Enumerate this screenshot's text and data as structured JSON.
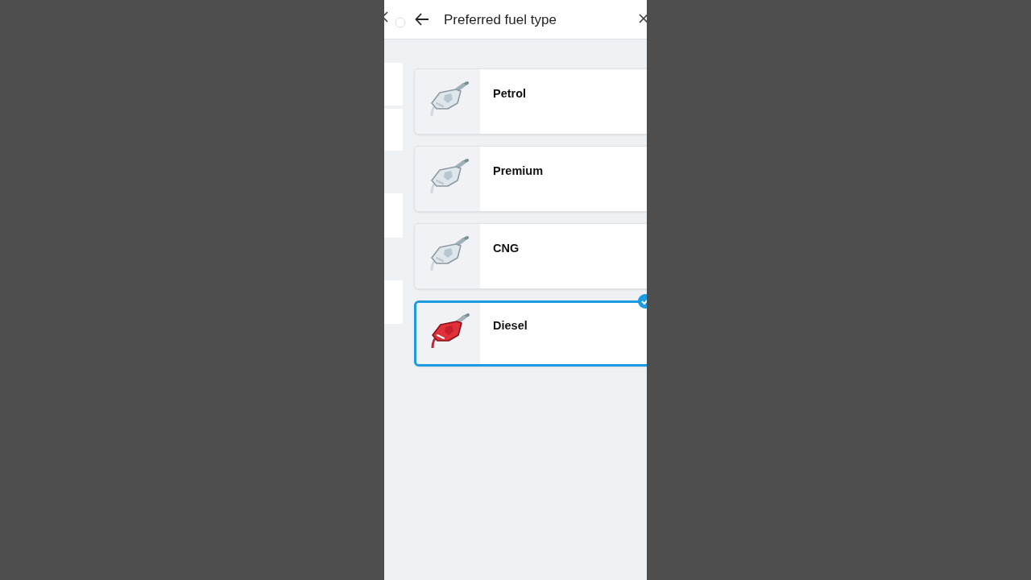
{
  "header": {
    "title": "Preferred fuel type"
  },
  "fuel_options": [
    {
      "label": "Petrol",
      "selected": false
    },
    {
      "label": "Premium",
      "selected": false
    },
    {
      "label": "CNG",
      "selected": false
    },
    {
      "label": "Diesel",
      "selected": true
    }
  ]
}
